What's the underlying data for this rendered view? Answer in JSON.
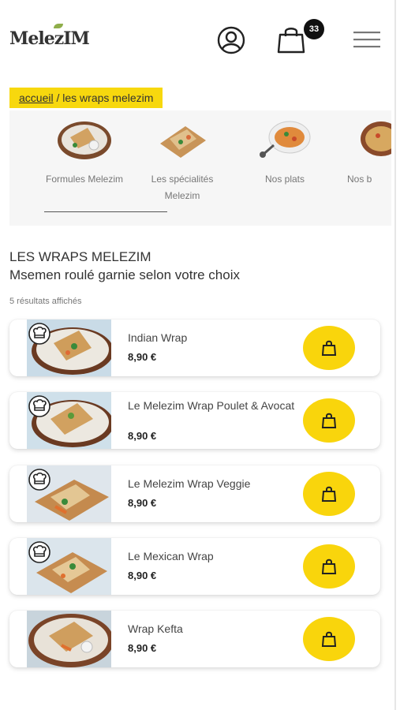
{
  "header": {
    "logo": "MelezIM",
    "cart_count": "33"
  },
  "breadcrumb": {
    "home": "accueil",
    "separator": " / ",
    "current": "les wraps melezim"
  },
  "categories": [
    {
      "label": "Formules Melezim"
    },
    {
      "label": "Les spécialités Melezim"
    },
    {
      "label": "Nos plats"
    },
    {
      "label": "Nos b"
    }
  ],
  "page": {
    "title": "LES WRAPS MELEZIM",
    "subtitle": "Msemen roulé garnie selon votre choix",
    "results": "5 résultats affichés"
  },
  "products": [
    {
      "name": "Indian Wrap",
      "price": "8,90 €"
    },
    {
      "name": "Le Melezim Wrap Poulet & Avocat",
      "price": "8,90 €"
    },
    {
      "name": "Le Melezim Wrap Veggie",
      "price": "8,90 €"
    },
    {
      "name": "Le Mexican Wrap",
      "price": "8,90 €"
    },
    {
      "name": "Wrap Kefta",
      "price": "8,90 €"
    }
  ],
  "colors": {
    "accent": "#f9d50c",
    "breadcrumb_bg": "#f7d80e"
  },
  "icons": [
    "account-icon",
    "shopping-bag-icon",
    "hamburger-menu-icon",
    "chef-hat-icon",
    "add-to-cart-bag-icon"
  ]
}
